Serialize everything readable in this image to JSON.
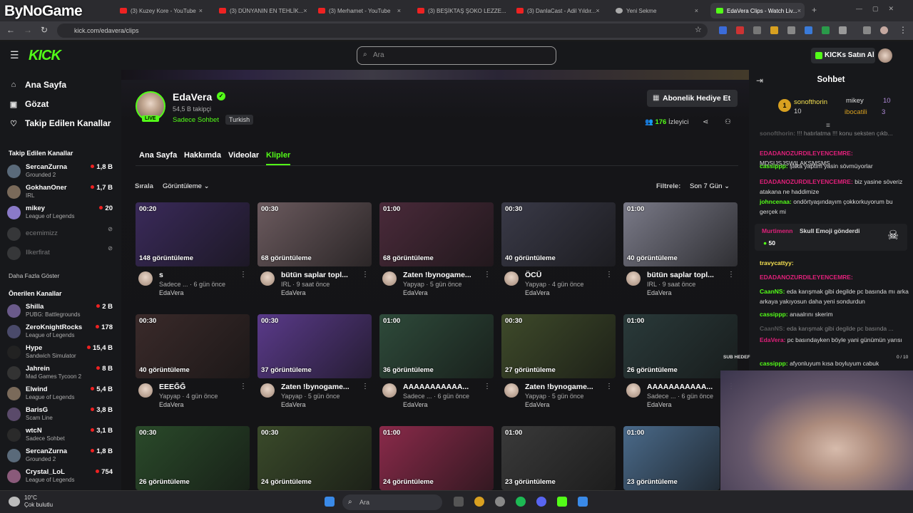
{
  "browser": {
    "overlay_logo": "ByNoGame",
    "tabs": [
      {
        "label": "(3) Kuzey Kore - YouTube"
      },
      {
        "label": "(3) DÜNYANIN EN TEHLİK..."
      },
      {
        "label": "(3) Merhamet - YouTube"
      },
      {
        "label": "(3) BEŞİKTAŞ ŞOKO LEZZE..."
      },
      {
        "label": "(3) DanlaCast - Adil Yıldır..."
      },
      {
        "label": "Yeni Sekme"
      },
      {
        "label": "EdaVera Clips - Watch Liv..."
      }
    ],
    "url": "kick.com/edavera/clips"
  },
  "topnav": {
    "logo": "KICK",
    "search_placeholder": "Ara",
    "buy_kicks_label": "KICKs Satın Al"
  },
  "sidebar": {
    "main_items": [
      {
        "label": "Ana Sayfa",
        "icon": "home-icon"
      },
      {
        "label": "Gözat",
        "icon": "browse-icon"
      },
      {
        "label": "Takip Edilen Kanallar",
        "icon": "heart-icon"
      }
    ],
    "followed_heading": "Takip Edilen Kanallar",
    "followed": [
      {
        "name": "SercanZurna",
        "category": "Grounded 2",
        "viewers": "1,8 B"
      },
      {
        "name": "GokhanOner",
        "category": "IRL",
        "viewers": "1,7 B"
      },
      {
        "name": "mikey",
        "category": "League of Legends",
        "viewers": "20"
      },
      {
        "name": "ecemimizz",
        "category": "",
        "viewers": ""
      },
      {
        "name": "Ilkerfirat",
        "category": "",
        "viewers": ""
      }
    ],
    "show_more": "Daha Fazla Göster",
    "recommended_heading": "Önerilen Kanallar",
    "recommended": [
      {
        "name": "Shilla",
        "category": "PUBG: Battlegrounds",
        "viewers": "2 B"
      },
      {
        "name": "ZeroKnightRocks",
        "category": "League of Legends",
        "viewers": "178"
      },
      {
        "name": "Hype",
        "category": "Sandwich Simulator",
        "viewers": "15,4 B"
      },
      {
        "name": "Jahrein",
        "category": "Mad Games Tycoon 2",
        "viewers": "8 B"
      },
      {
        "name": "Elwind",
        "category": "League of Legends",
        "viewers": "5,4 B"
      },
      {
        "name": "BarisG",
        "category": "Scam Line",
        "viewers": "3,8 B"
      },
      {
        "name": "wtcN",
        "category": "Sadece Sohbet",
        "viewers": "3,1 B"
      },
      {
        "name": "SercanZurna",
        "category": "Grounded 2",
        "viewers": "1,8 B"
      },
      {
        "name": "Crystal_LoL",
        "category": "League of Legends",
        "viewers": "754"
      }
    ]
  },
  "channel": {
    "live_badge": "LIVE",
    "name": "EdaVera",
    "followers": "54,5 B takipçi",
    "category": "Sadece Sohbet",
    "language": "Turkish",
    "gift_label": "Abonelik Hediye Et",
    "viewers_count": "176",
    "viewers_label": "İzleyici",
    "tabs": [
      "Ana Sayfa",
      "Hakkımda",
      "Videolar",
      "Klipler"
    ]
  },
  "clips_toolbar": {
    "sort_label": "Sırala",
    "sort_value": "Görüntüleme",
    "filter_label": "Filtrele:",
    "filter_value": "Son 7 Gün"
  },
  "clips": [
    {
      "duration": "00:20",
      "views": "148 görüntüleme",
      "title": "s",
      "meta": "Sadece ... · 6 gün önce",
      "channel": "EdaVera",
      "color": "#3a2a5a"
    },
    {
      "duration": "00:30",
      "views": "68 görüntüleme",
      "title": "bütün saplar topl...",
      "meta": "IRL · 9 saat önce",
      "channel": "EdaVera",
      "color": "#6b5a5e"
    },
    {
      "duration": "01:00",
      "views": "68 görüntüleme",
      "title": "Zaten !bynogame...",
      "meta": "Yapyap · 5 gün önce",
      "channel": "EdaVera",
      "color": "#4a2a3a"
    },
    {
      "duration": "00:30",
      "views": "40 görüntüleme",
      "title": "ÖCÜ",
      "meta": "Yapyap · 4 gün önce",
      "channel": "EdaVera",
      "color": "#3a3a48"
    },
    {
      "duration": "01:00",
      "views": "40 görüntüleme",
      "title": "bütün saplar topl...",
      "meta": "IRL · 9 saat önce",
      "channel": "EdaVera",
      "color": "#7a7a88"
    },
    {
      "duration": "00:30",
      "views": "40 görüntüleme",
      "title": "EEEĞĞ",
      "meta": "Yapyap · 4 gün önce",
      "channel": "EdaVera",
      "color": "#3a2a2a"
    },
    {
      "duration": "00:30",
      "views": "37 görüntüleme",
      "title": "Zaten !bynogame...",
      "meta": "Yapyap · 5 gün önce",
      "channel": "EdaVera",
      "color": "#5a3a8a"
    },
    {
      "duration": "01:00",
      "views": "36 görüntüleme",
      "title": "AAAAAAAAAAA...",
      "meta": "Sadece ... · 6 gün önce",
      "channel": "EdaVera",
      "color": "#2e4a3a"
    },
    {
      "duration": "00:30",
      "views": "27 görüntüleme",
      "title": "Zaten !bynogame...",
      "meta": "Yapyap · 5 gün önce",
      "channel": "EdaVera",
      "color": "#3e4a2a"
    },
    {
      "duration": "01:00",
      "views": "26 görüntüleme",
      "title": "AAAAAAAAAAA...",
      "meta": "Sadece ... · 6 gün önce",
      "channel": "EdaVera",
      "color": "#2a3a3a"
    },
    {
      "duration": "00:30",
      "views": "26 görüntüleme",
      "title": "",
      "meta": "",
      "channel": "",
      "color": "#2a4a2a"
    },
    {
      "duration": "00:30",
      "views": "24 görüntüleme",
      "title": "",
      "meta": "",
      "channel": "",
      "color": "#3a4a2a"
    },
    {
      "duration": "01:00",
      "views": "24 görüntüleme",
      "title": "",
      "meta": "",
      "channel": "",
      "color": "#8a2a4a"
    },
    {
      "duration": "01:00",
      "views": "23 görüntüleme",
      "title": "",
      "meta": "",
      "channel": "",
      "color": "#3a3a3a"
    },
    {
      "duration": "01:00",
      "views": "23 görüntüleme",
      "title": "",
      "meta": "",
      "channel": "",
      "color": "#4a6a8a"
    }
  ],
  "chat": {
    "title": "Sohbet",
    "top_gifters": [
      {
        "rank": "1",
        "name": "sonofthorin",
        "count": "10"
      },
      {
        "name": "mikey",
        "count": "10"
      },
      {
        "name": "ibocatili",
        "count": "3"
      }
    ],
    "messages": [
      {
        "user": "sonofthorin:",
        "text": "!!! hatırlatma !!! konu seksten çıkb...",
        "color": "#888"
      },
      {
        "user": "EDADANOZURDILEYENCEMRE:",
        "text": "MDSIJSJSWILAKSMSMS",
        "color": "#e0207a"
      },
      {
        "user": "cassippp:",
        "text": "şaka yaptım yasin sövmüyorlar",
        "color": "#53fc18"
      },
      {
        "user": "EDADANOZURDILEYENCEMRE:",
        "text": "biz yasine söveriz atakana ne haddimize",
        "color": "#e0207a"
      },
      {
        "user": "johncenaa:",
        "text": "ondörtyaşındayım çokkorkuyorum bu gerçek mi",
        "color": "#53fc18"
      },
      {
        "user": "travycattyy:",
        "text": "",
        "color": "#f5e050"
      },
      {
        "user": "EDADANOZURDILEYENCEMRE:",
        "text": "",
        "color": "#e0207a"
      },
      {
        "user": "CaanNS:",
        "text": "eda karışmak gibi degilde pc basında mı arka arkaya yakıyosun daha yeni sondurdun",
        "color": "#53fc18"
      },
      {
        "user": "cassippp:",
        "text": "anaalrını skerim",
        "color": "#53fc18"
      },
      {
        "user": "CaanNS:",
        "text": "eda karışmak gibi degilde pc basında ...",
        "color": "#888"
      },
      {
        "user": "EdaVera:",
        "text": "pc basındayken böyle yani günümün yarısı",
        "color": "#e0207a"
      },
      {
        "user": "cassippp:",
        "text": "afyonluyum kısa boyluyum cabuk",
        "color": "#53fc18"
      }
    ],
    "pinned": {
      "user": "Murtimenn",
      "text": "Skull Emoji gönderdi",
      "count": "50"
    },
    "sub_goal_label": "SUB HEDEF",
    "sub_goal_value": "0 / 10"
  },
  "taskbar": {
    "temperature": "10°C",
    "weather": "Çok bulutlu",
    "search": "Ara"
  }
}
